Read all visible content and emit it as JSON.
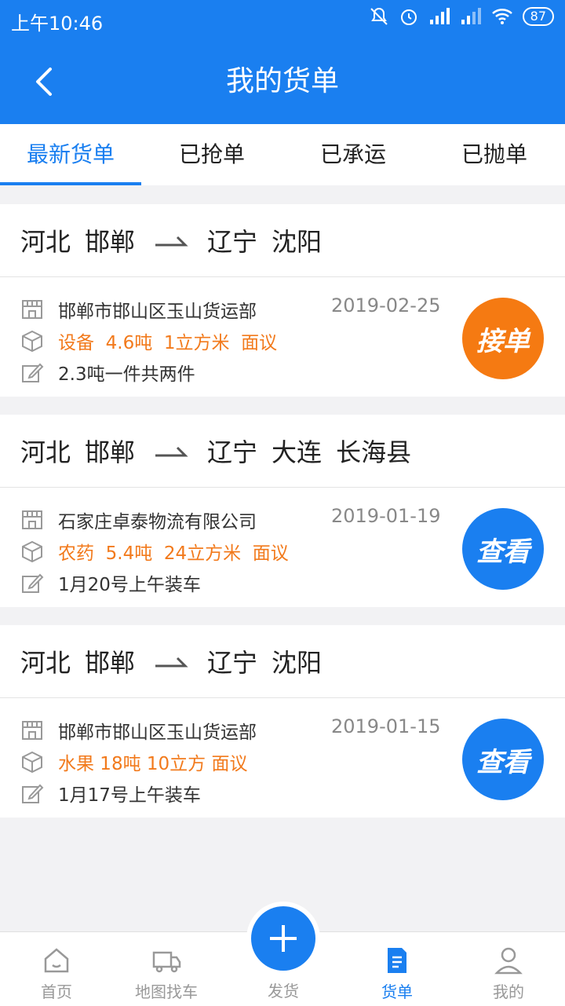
{
  "status": {
    "time": "上午10:46",
    "battery": "87"
  },
  "header": {
    "title": "我的货单"
  },
  "tabs": [
    {
      "label": "最新货单"
    },
    {
      "label": "已抢单"
    },
    {
      "label": "已承运"
    },
    {
      "label": "已抛单"
    }
  ],
  "orders": [
    {
      "from": [
        "河北",
        "邯郸"
      ],
      "to": [
        "辽宁",
        "沈阳"
      ],
      "company": "邯郸市邯山区玉山货运部",
      "date": "2019-02-25",
      "goods": "设备  4.6吨  1立方米  面议",
      "note": "2.3吨一件共两件",
      "action": "接单",
      "action_color": "#f57a12"
    },
    {
      "from": [
        "河北",
        "邯郸"
      ],
      "to": [
        "辽宁",
        "大连",
        "长海县"
      ],
      "company": "石家庄卓泰物流有限公司",
      "date": "2019-01-19",
      "goods": "农药  5.4吨  24立方米  面议",
      "note": "1月20号上午装车",
      "action": "查看",
      "action_color": "#1a7ff0"
    },
    {
      "from": [
        "河北",
        "邯郸"
      ],
      "to": [
        "辽宁",
        "沈阳"
      ],
      "company": "邯郸市邯山区玉山货运部",
      "date": "2019-01-15",
      "goods": "水果 18吨 10立方 面议",
      "note": "1月17号上午装车",
      "action": "查看",
      "action_color": "#1a7ff0"
    }
  ],
  "nav": {
    "home": "首页",
    "map": "地图找车",
    "ship": "发货",
    "orders": "货单",
    "mine": "我的"
  },
  "colors": {
    "primary": "#1a7ff0",
    "accent": "#f57a12",
    "goods_text": "#f27a1c"
  }
}
